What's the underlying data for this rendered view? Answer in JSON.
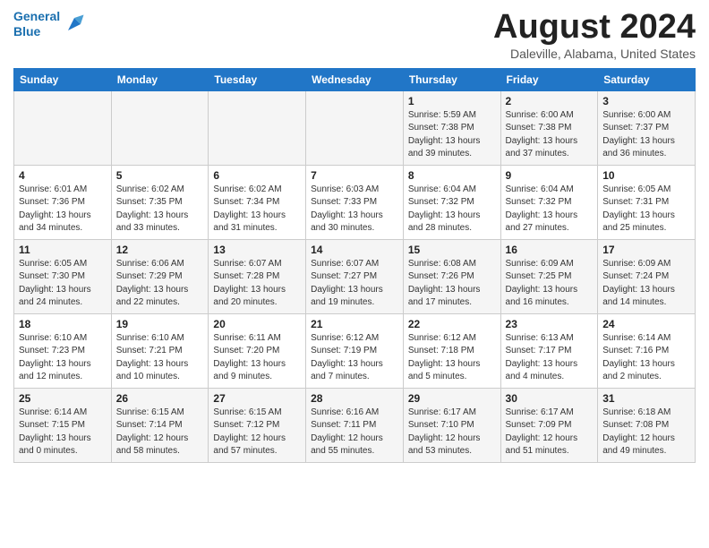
{
  "header": {
    "logo_line1": "General",
    "logo_line2": "Blue",
    "month": "August 2024",
    "location": "Daleville, Alabama, United States"
  },
  "weekdays": [
    "Sunday",
    "Monday",
    "Tuesday",
    "Wednesday",
    "Thursday",
    "Friday",
    "Saturday"
  ],
  "weeks": [
    [
      {
        "day": "",
        "info": ""
      },
      {
        "day": "",
        "info": ""
      },
      {
        "day": "",
        "info": ""
      },
      {
        "day": "",
        "info": ""
      },
      {
        "day": "1",
        "info": "Sunrise: 5:59 AM\nSunset: 7:38 PM\nDaylight: 13 hours\nand 39 minutes."
      },
      {
        "day": "2",
        "info": "Sunrise: 6:00 AM\nSunset: 7:38 PM\nDaylight: 13 hours\nand 37 minutes."
      },
      {
        "day": "3",
        "info": "Sunrise: 6:00 AM\nSunset: 7:37 PM\nDaylight: 13 hours\nand 36 minutes."
      }
    ],
    [
      {
        "day": "4",
        "info": "Sunrise: 6:01 AM\nSunset: 7:36 PM\nDaylight: 13 hours\nand 34 minutes."
      },
      {
        "day": "5",
        "info": "Sunrise: 6:02 AM\nSunset: 7:35 PM\nDaylight: 13 hours\nand 33 minutes."
      },
      {
        "day": "6",
        "info": "Sunrise: 6:02 AM\nSunset: 7:34 PM\nDaylight: 13 hours\nand 31 minutes."
      },
      {
        "day": "7",
        "info": "Sunrise: 6:03 AM\nSunset: 7:33 PM\nDaylight: 13 hours\nand 30 minutes."
      },
      {
        "day": "8",
        "info": "Sunrise: 6:04 AM\nSunset: 7:32 PM\nDaylight: 13 hours\nand 28 minutes."
      },
      {
        "day": "9",
        "info": "Sunrise: 6:04 AM\nSunset: 7:32 PM\nDaylight: 13 hours\nand 27 minutes."
      },
      {
        "day": "10",
        "info": "Sunrise: 6:05 AM\nSunset: 7:31 PM\nDaylight: 13 hours\nand 25 minutes."
      }
    ],
    [
      {
        "day": "11",
        "info": "Sunrise: 6:05 AM\nSunset: 7:30 PM\nDaylight: 13 hours\nand 24 minutes."
      },
      {
        "day": "12",
        "info": "Sunrise: 6:06 AM\nSunset: 7:29 PM\nDaylight: 13 hours\nand 22 minutes."
      },
      {
        "day": "13",
        "info": "Sunrise: 6:07 AM\nSunset: 7:28 PM\nDaylight: 13 hours\nand 20 minutes."
      },
      {
        "day": "14",
        "info": "Sunrise: 6:07 AM\nSunset: 7:27 PM\nDaylight: 13 hours\nand 19 minutes."
      },
      {
        "day": "15",
        "info": "Sunrise: 6:08 AM\nSunset: 7:26 PM\nDaylight: 13 hours\nand 17 minutes."
      },
      {
        "day": "16",
        "info": "Sunrise: 6:09 AM\nSunset: 7:25 PM\nDaylight: 13 hours\nand 16 minutes."
      },
      {
        "day": "17",
        "info": "Sunrise: 6:09 AM\nSunset: 7:24 PM\nDaylight: 13 hours\nand 14 minutes."
      }
    ],
    [
      {
        "day": "18",
        "info": "Sunrise: 6:10 AM\nSunset: 7:23 PM\nDaylight: 13 hours\nand 12 minutes."
      },
      {
        "day": "19",
        "info": "Sunrise: 6:10 AM\nSunset: 7:21 PM\nDaylight: 13 hours\nand 10 minutes."
      },
      {
        "day": "20",
        "info": "Sunrise: 6:11 AM\nSunset: 7:20 PM\nDaylight: 13 hours\nand 9 minutes."
      },
      {
        "day": "21",
        "info": "Sunrise: 6:12 AM\nSunset: 7:19 PM\nDaylight: 13 hours\nand 7 minutes."
      },
      {
        "day": "22",
        "info": "Sunrise: 6:12 AM\nSunset: 7:18 PM\nDaylight: 13 hours\nand 5 minutes."
      },
      {
        "day": "23",
        "info": "Sunrise: 6:13 AM\nSunset: 7:17 PM\nDaylight: 13 hours\nand 4 minutes."
      },
      {
        "day": "24",
        "info": "Sunrise: 6:14 AM\nSunset: 7:16 PM\nDaylight: 13 hours\nand 2 minutes."
      }
    ],
    [
      {
        "day": "25",
        "info": "Sunrise: 6:14 AM\nSunset: 7:15 PM\nDaylight: 13 hours\nand 0 minutes."
      },
      {
        "day": "26",
        "info": "Sunrise: 6:15 AM\nSunset: 7:14 PM\nDaylight: 12 hours\nand 58 minutes."
      },
      {
        "day": "27",
        "info": "Sunrise: 6:15 AM\nSunset: 7:12 PM\nDaylight: 12 hours\nand 57 minutes."
      },
      {
        "day": "28",
        "info": "Sunrise: 6:16 AM\nSunset: 7:11 PM\nDaylight: 12 hours\nand 55 minutes."
      },
      {
        "day": "29",
        "info": "Sunrise: 6:17 AM\nSunset: 7:10 PM\nDaylight: 12 hours\nand 53 minutes."
      },
      {
        "day": "30",
        "info": "Sunrise: 6:17 AM\nSunset: 7:09 PM\nDaylight: 12 hours\nand 51 minutes."
      },
      {
        "day": "31",
        "info": "Sunrise: 6:18 AM\nSunset: 7:08 PM\nDaylight: 12 hours\nand 49 minutes."
      }
    ]
  ]
}
